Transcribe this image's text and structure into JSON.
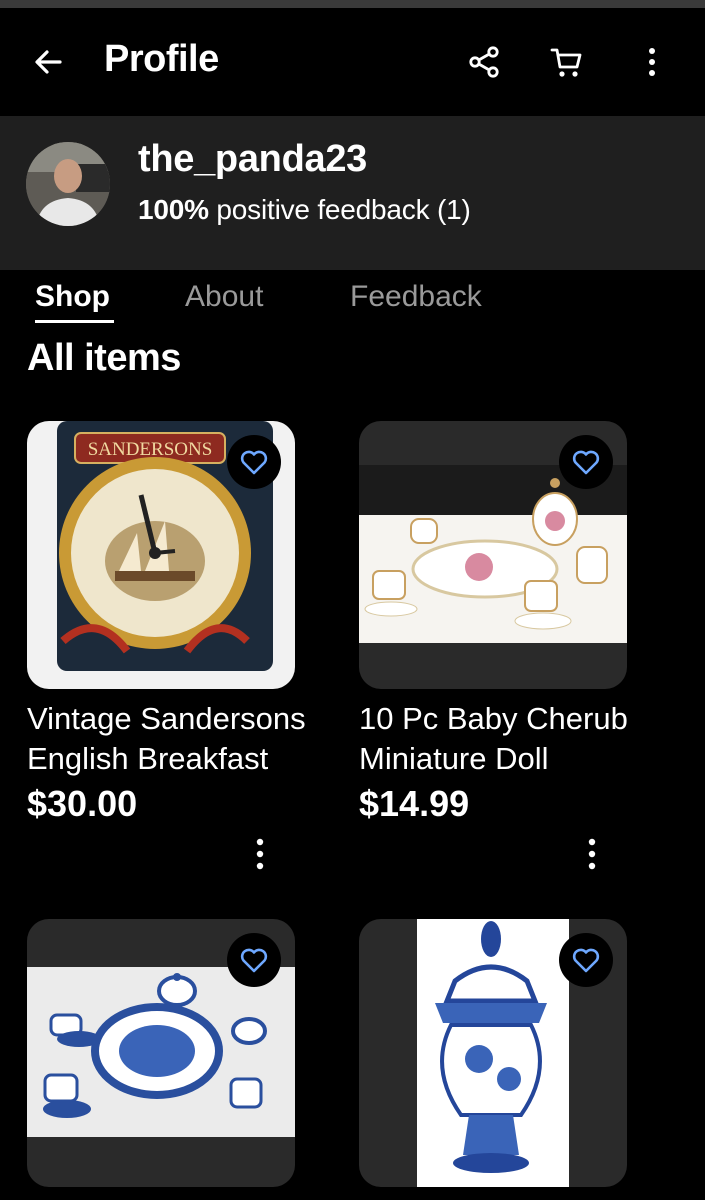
{
  "header": {
    "title": "Profile",
    "icons": [
      "back-arrow-icon",
      "share-icon",
      "cart-icon",
      "more-vertical-icon"
    ]
  },
  "profile": {
    "username": "the_panda23",
    "feedback_percent": "100%",
    "feedback_text": "positive feedback (1)"
  },
  "tabs": [
    {
      "label": "Shop",
      "active": true
    },
    {
      "label": "About",
      "active": false
    },
    {
      "label": "Feedback",
      "active": false
    }
  ],
  "section_title": "All items",
  "items": [
    {
      "title": "Vintage Sandersons English Breakfast",
      "price": "$30.00",
      "image_text": "SANDERSONS"
    },
    {
      "title": "10 Pc Baby Cherub Miniature Doll",
      "price": "$14.99"
    },
    {
      "title": "",
      "price": ""
    },
    {
      "title": "",
      "price": ""
    }
  ],
  "colors": {
    "background": "#000000",
    "header_panel": "#1f1f1f",
    "heart": "#6ea8ff",
    "inactive_tab": "#9a9a9a"
  }
}
